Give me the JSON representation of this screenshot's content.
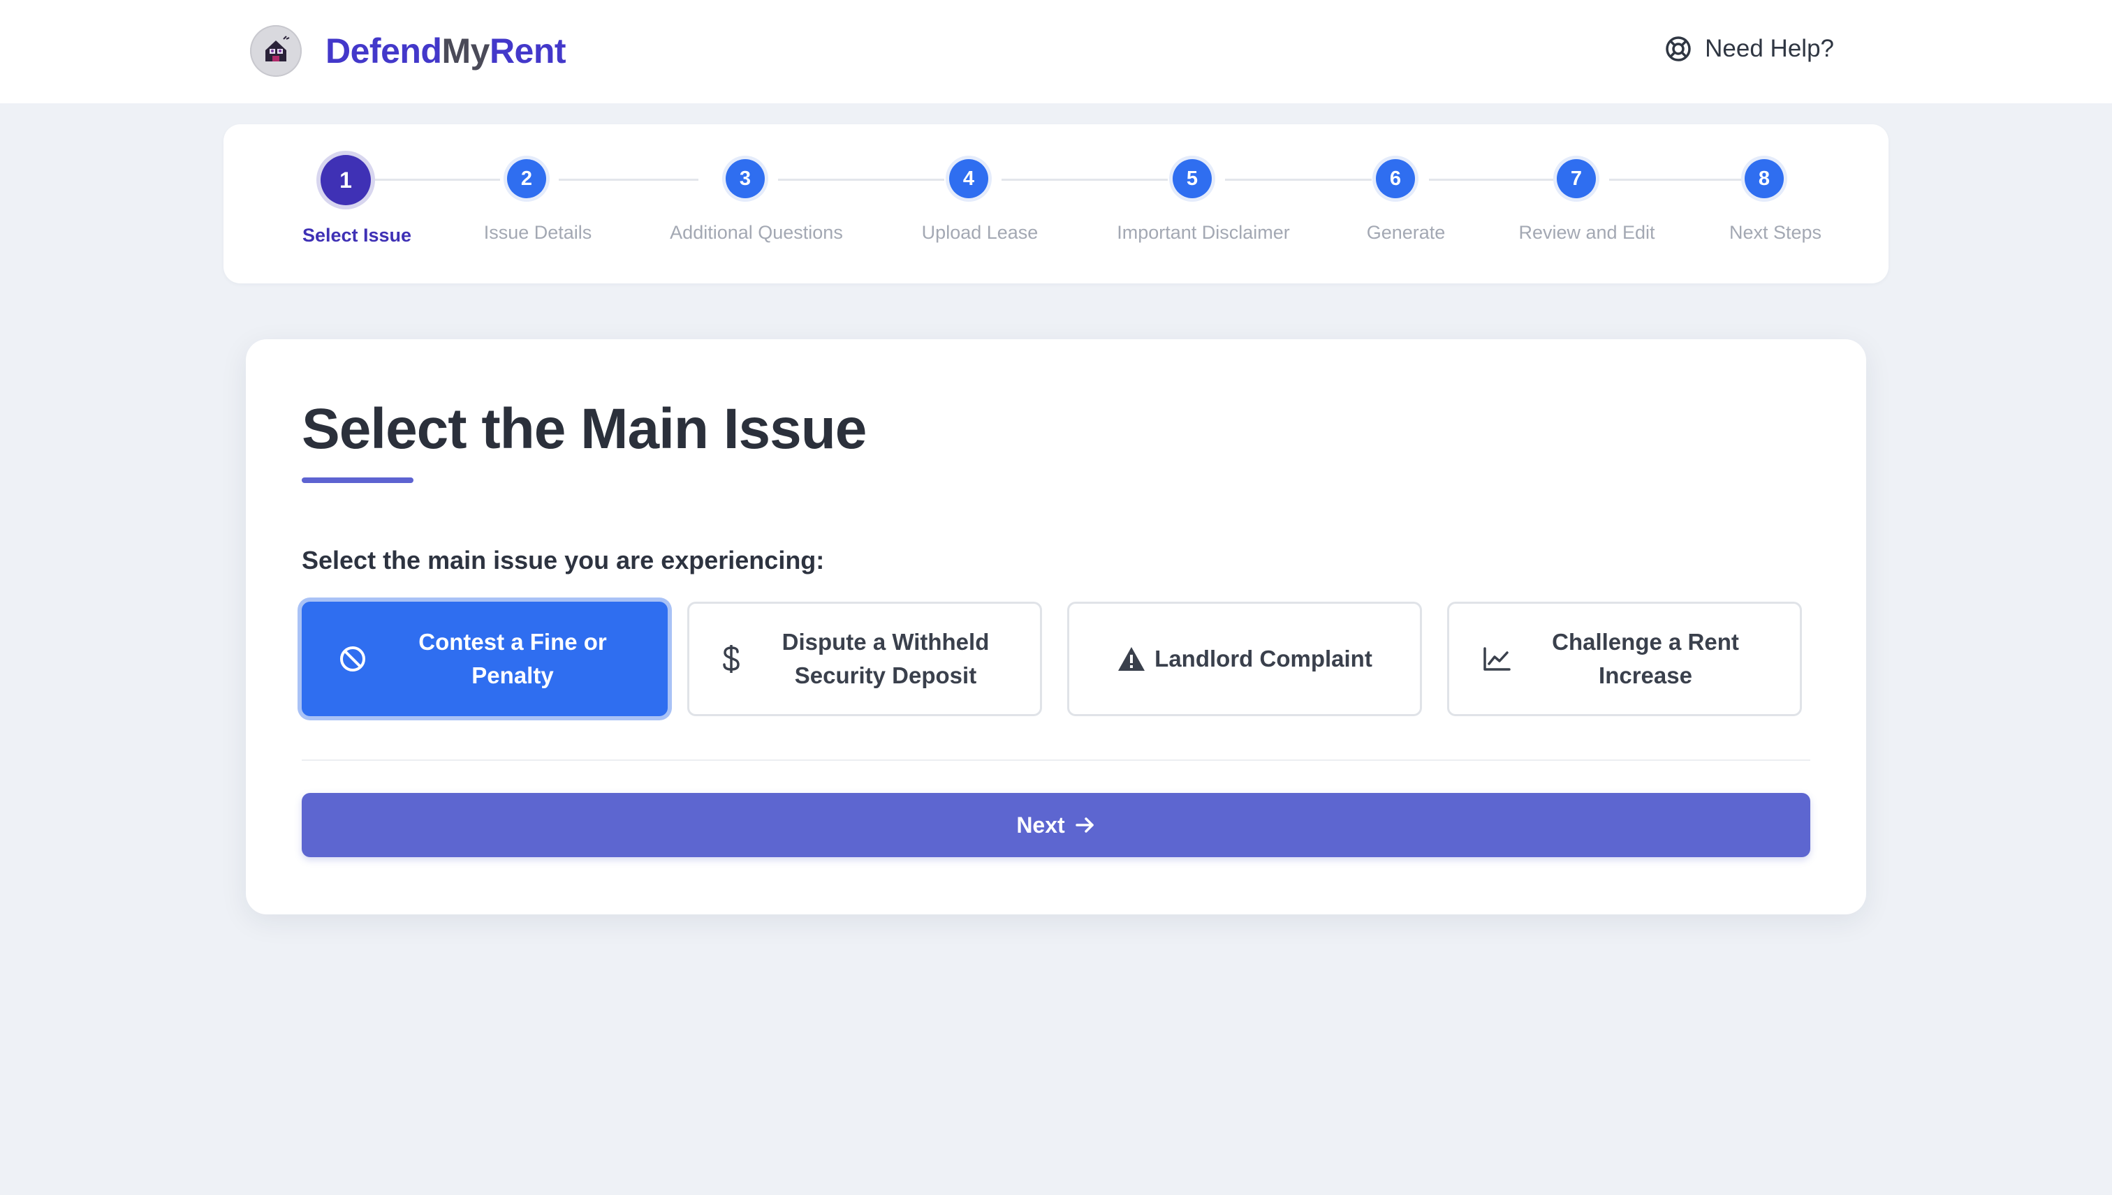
{
  "header": {
    "brand_part1": "Defend",
    "brand_part2": "My",
    "brand_part3": "Rent",
    "logo_icon": "house-mascot-logo-icon",
    "help_icon": "lifebuoy-icon",
    "help_label": "Need Help?"
  },
  "stepper": {
    "steps": [
      {
        "number": "1",
        "label": "Select Issue",
        "active": true
      },
      {
        "number": "2",
        "label": "Issue Details",
        "active": false
      },
      {
        "number": "3",
        "label": "Additional Questions",
        "active": false
      },
      {
        "number": "4",
        "label": "Upload Lease",
        "active": false
      },
      {
        "number": "5",
        "label": "Important Disclaimer",
        "active": false
      },
      {
        "number": "6",
        "label": "Generate",
        "active": false
      },
      {
        "number": "7",
        "label": "Review and Edit",
        "active": false
      },
      {
        "number": "8",
        "label": "Next Steps",
        "active": false
      }
    ]
  },
  "main": {
    "title": "Select the Main Issue",
    "prompt": "Select the main issue you are experiencing:",
    "options": [
      {
        "label": "Contest a Fine or Penalty",
        "line1": "Contest a Fine or",
        "line2": "Penalty",
        "icon": "ban-icon",
        "selected": true
      },
      {
        "label": "Dispute a Withheld Security Deposit",
        "line1": "Dispute a Withheld",
        "line2": "Security Deposit",
        "icon": "dollar-icon",
        "selected": false
      },
      {
        "label": "Landlord Complaint",
        "line1": "Landlord Complaint",
        "line2": "",
        "icon": "warning-icon",
        "selected": false
      },
      {
        "label": "Challenge a Rent Increase",
        "line1": "Challenge a Rent",
        "line2": "Increase",
        "icon": "chart-line-icon",
        "selected": false
      }
    ],
    "next_label": "Next",
    "next_icon": "arrow-right-icon"
  },
  "colors": {
    "brand_primary": "#4338ca",
    "selected_blue": "#2f6ef0",
    "next_button": "#5d66d0",
    "background": "#eef1f6"
  }
}
